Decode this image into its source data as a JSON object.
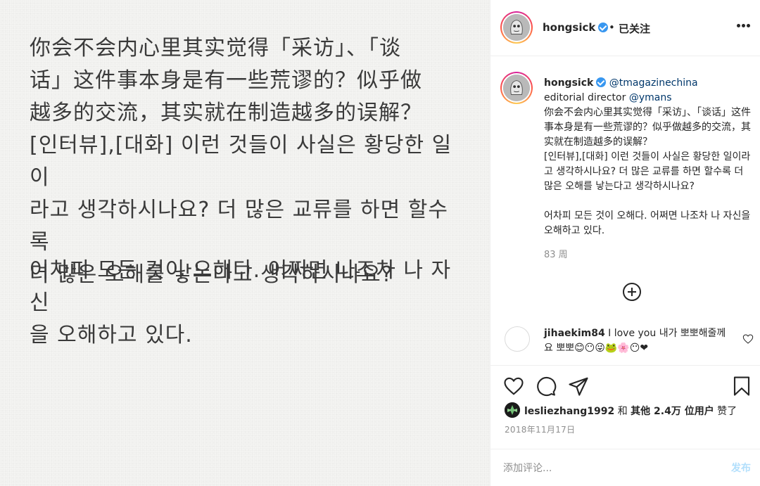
{
  "post_image": {
    "paragraph1": "你会不会内心里其实觉得「采访」、「谈\n话」这件事本身是有一些荒谬的？似乎做\n越多的交流，其实就在制造越多的误解？\n[인터뷰],[대화] 이런 것들이 사실은 황당한 일이\n라고 생각하시나요? 더 많은 교류를 하면 할수록\n더 많은 오해를 낳는다고 생각하시나요?",
    "paragraph2": "어차피 모든 것이 오해다. 어쩌면 나조차 나 자신\n을 오해하고 있다."
  },
  "header": {
    "username": "hongsick",
    "dot": "•",
    "follow_status": "已关注",
    "more": "more-options"
  },
  "caption": {
    "username": "hongsick",
    "mention1": "@tmagazinechina",
    "line2_prefix": "editorial director ",
    "mention2": "@ymans",
    "text": "你会不会内心里其实觉得「采访」、「谈话」这件事本身是有一些荒谬的？似乎做越多的交流，其实就在制造越多的误解？\n[인터뷰],[대화] 이런 것들이 사실은 황당한 일이라고 생각하시나요? 더 많은 교류를 하면 할수록 더 많은 오해를 낳는다고 생각하시나요?\n\n어차피 모든 것이 오해다. 어쩌면 나조차 나 자신을 오해하고 있다.",
    "time": "83 周"
  },
  "comment": {
    "username": "jihaekim84",
    "text": " I love you 내가 뽀뽀해줄께요 뽀뽀😊😶😜🐸🌸😶❤"
  },
  "likes": {
    "user": "lesliezhang1992",
    "and": " 和 ",
    "others": "其他 2.4万 位用户",
    "liked": " 赞了"
  },
  "date": "2018年11月17日",
  "add_comment": {
    "placeholder": "添加评论...",
    "publish": "发布"
  },
  "colors": {
    "verified": "#3897f0",
    "link": "#00376b",
    "publish_disabled": "#b2dffc"
  }
}
